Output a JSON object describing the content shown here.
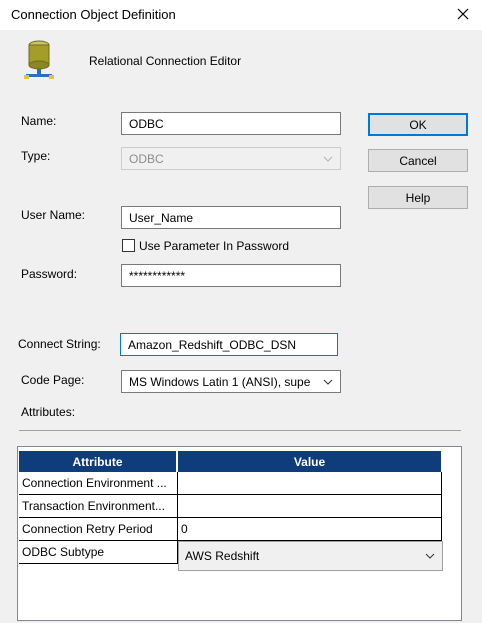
{
  "window": {
    "title": "Connection Object Definition",
    "close_glyph": "✕"
  },
  "header": {
    "editor_label": "Relational Connection Editor",
    "icon": "database-icon"
  },
  "form": {
    "name_label": "Name:",
    "name_value": "ODBC",
    "type_label": "Type:",
    "type_value": "ODBC",
    "user_label": "User Name:",
    "user_value": "User_Name",
    "use_param_label": "Use Parameter In Password",
    "use_param_checked": false,
    "password_label": "Password:",
    "password_value": "************",
    "connect_label": "Connect String:",
    "connect_value": "Amazon_Redshift_ODBC_DSN",
    "codepage_label": "Code Page:",
    "codepage_value": "MS Windows Latin 1 (ANSI), supe",
    "attributes_label": "Attributes:"
  },
  "buttons": {
    "ok": "OK",
    "cancel": "Cancel",
    "help": "Help"
  },
  "grid": {
    "headers": [
      "Attribute",
      "Value"
    ],
    "rows": [
      {
        "attribute": "Connection Environment ...",
        "value": ""
      },
      {
        "attribute": "Transaction Environment...",
        "value": ""
      },
      {
        "attribute": "Connection Retry Period",
        "value": "0"
      },
      {
        "attribute": "ODBC Subtype",
        "value": "AWS Redshift"
      }
    ]
  },
  "colors": {
    "header_bg": "#0f3c7a",
    "accent": "#0078d7"
  }
}
